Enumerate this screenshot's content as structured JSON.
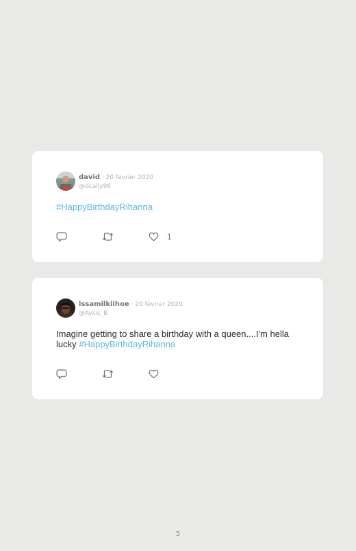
{
  "tweets": [
    {
      "name": "david",
      "date": " · 20 février 2020",
      "handle": "@dcally96",
      "text": "",
      "hashtag": "#HappyBirthdayRihanna",
      "like_count": "1",
      "icons": [
        "reply-icon",
        "retweet-icon",
        "like-icon"
      ]
    },
    {
      "name": "issamilkiihoe",
      "date": " · 20 février 2020",
      "handle": "@Aysis_B",
      "text": "Imagine getting to share a birthday with a queen....I'm hella lucky ",
      "hashtag": "#HappyBirthdayRihanna",
      "like_count": "",
      "icons": [
        "reply-icon",
        "retweet-icon",
        "like-icon"
      ]
    }
  ],
  "page_number": "5",
  "colors": {
    "background": "#e9e9e7",
    "card": "#ffffff",
    "hashtag": "#5bb7e6",
    "name": "#6f7479",
    "muted": "#aeb3b8",
    "icon": "#6f7479"
  }
}
